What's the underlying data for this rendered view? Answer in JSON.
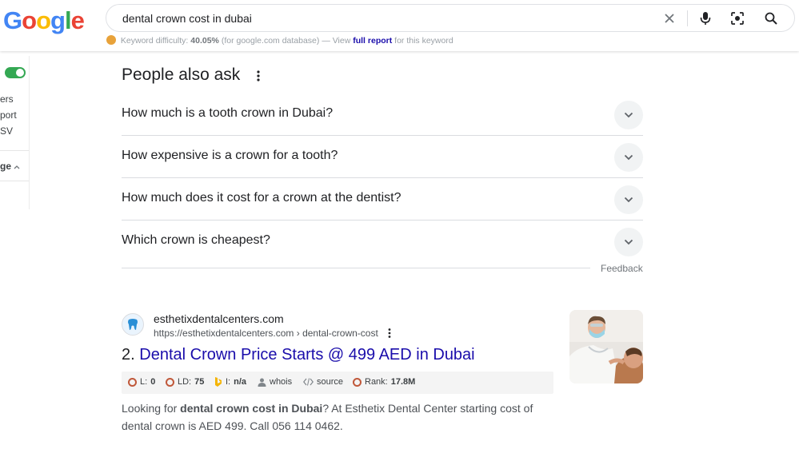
{
  "header": {
    "logo": {
      "G": "G",
      "o1": "o",
      "o2": "o",
      "g": "g",
      "l": "l",
      "e": "e"
    },
    "search_value": "dental crown cost in dubai",
    "keyword": {
      "prefix": "Keyword difficulty:",
      "value": "40.05%",
      "db": "(for google.com database) — View",
      "link": "full report",
      "suffix": "for this keyword"
    }
  },
  "left_panel": {
    "items": [
      "ers",
      "port",
      "SV"
    ],
    "section": "ge"
  },
  "paa": {
    "title": "People also ask",
    "questions": [
      "How much is a tooth crown in Dubai?",
      "How expensive is a crown for a tooth?",
      "How much does it cost for a crown at the dentist?",
      "Which crown is cheapest?"
    ],
    "feedback": "Feedback"
  },
  "result": {
    "site_name": "esthetixdentalcenters.com",
    "url": "https://esthetixdentalcenters.com › dental-crown-cost",
    "number": "2.",
    "title": "Dental Crown Price Starts @ 499 AED in Dubai",
    "seo": {
      "l_label": "L:",
      "l_val": "0",
      "ld_label": "LD:",
      "ld_val": "75",
      "i_label": "I:",
      "i_val": "n/a",
      "whois": "whois",
      "source": "source",
      "rank_label": "Rank:",
      "rank_val": "17.8M"
    },
    "snippet": {
      "pre": "Looking for ",
      "bold": "dental crown cost in Dubai",
      "post": "? At Esthetix Dental Center starting cost of dental crown is AED 499. Call 056 114 0462."
    }
  },
  "colors": {
    "link": "#1a0dab",
    "toggle": "#34a853",
    "seo_ring": "#c0583a",
    "bing": "#f4b400"
  }
}
